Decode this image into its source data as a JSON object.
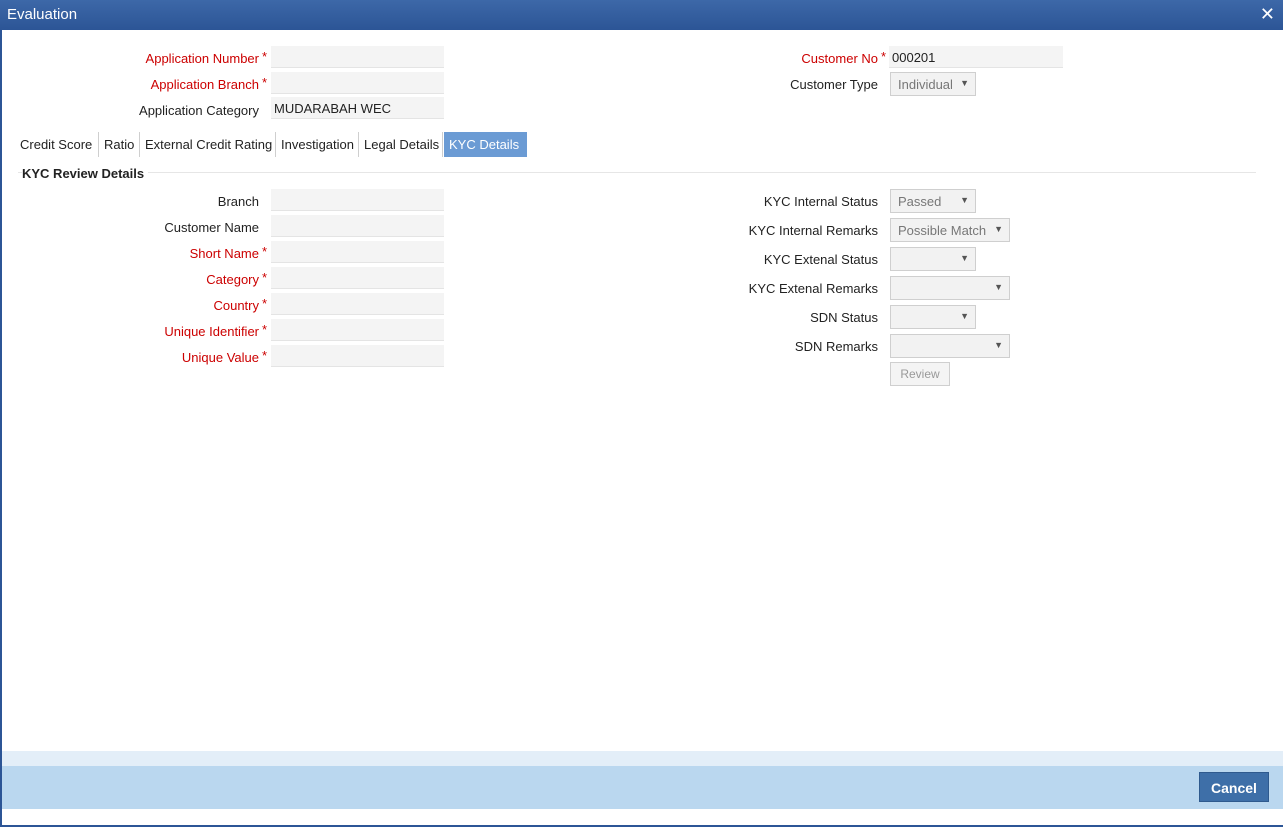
{
  "window": {
    "title": "Evaluation",
    "close_glyph": "✕"
  },
  "header": {
    "application_number": {
      "label": "Application Number",
      "value": ""
    },
    "application_branch": {
      "label": "Application Branch",
      "value": ""
    },
    "application_category": {
      "label": "Application Category",
      "value": "MUDARABAH WEC"
    },
    "customer_no": {
      "label": "Customer No",
      "value": "000201"
    },
    "customer_type": {
      "label": "Customer Type",
      "value": "Individual"
    },
    "required_mark": "*"
  },
  "tabs": [
    {
      "label": "Credit Score"
    },
    {
      "label": "Ratio"
    },
    {
      "label": "External Credit Rating"
    },
    {
      "label": "Investigation"
    },
    {
      "label": "Legal Details"
    },
    {
      "label": "KYC Details",
      "active": true
    }
  ],
  "kyc": {
    "section_title": "KYC Review Details",
    "branch": {
      "label": "Branch",
      "value": ""
    },
    "customer_name": {
      "label": "Customer Name",
      "value": ""
    },
    "short_name": {
      "label": "Short Name",
      "value": ""
    },
    "category": {
      "label": "Category",
      "value": ""
    },
    "country": {
      "label": "Country",
      "value": ""
    },
    "unique_identifier": {
      "label": "Unique Identifier",
      "value": ""
    },
    "unique_value": {
      "label": "Unique Value",
      "value": ""
    },
    "internal_status": {
      "label": "KYC Internal Status",
      "value": "Passed"
    },
    "internal_remarks": {
      "label": "KYC Internal Remarks",
      "value": "Possible Match"
    },
    "external_status": {
      "label": "KYC Extenal Status",
      "value": ""
    },
    "external_remarks": {
      "label": "KYC Extenal Remarks",
      "value": ""
    },
    "sdn_status": {
      "label": "SDN Status",
      "value": ""
    },
    "sdn_remarks": {
      "label": "SDN Remarks",
      "value": ""
    },
    "review_label": "Review"
  },
  "footer": {
    "cancel_label": "Cancel"
  },
  "icons": {
    "dropdown": "chevron-down-icon",
    "close": "close-icon"
  }
}
